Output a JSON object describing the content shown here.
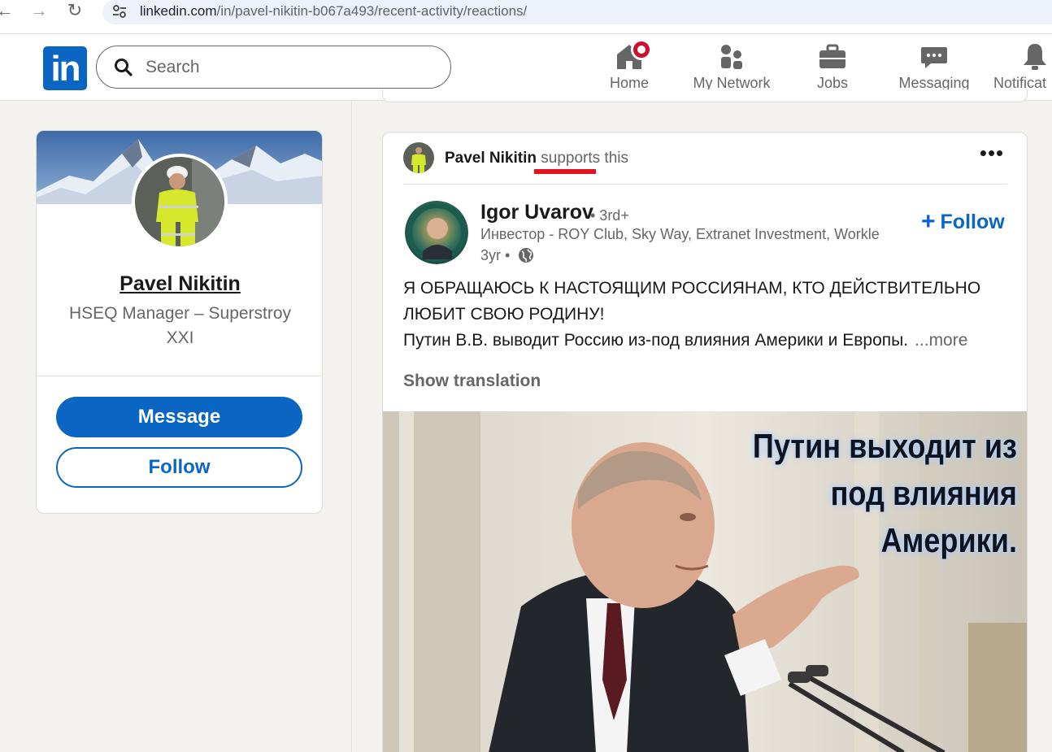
{
  "browser": {
    "url_host": "linkedin.com",
    "url_path": "/in/pavel-nikitin-b067a493/recent-activity/reactions/"
  },
  "header": {
    "logo_text": "in",
    "search_placeholder": "Search",
    "nav": [
      {
        "label": "Home",
        "icon": "home-icon",
        "has_notification": true
      },
      {
        "label": "My Network",
        "icon": "people-icon"
      },
      {
        "label": "Jobs",
        "icon": "briefcase-icon"
      },
      {
        "label": "Messaging",
        "icon": "chat-icon"
      },
      {
        "label": "Notificat",
        "icon": "bell-icon"
      }
    ]
  },
  "profile_card": {
    "name": "Pavel Nikitin",
    "headline": "HSEQ Manager – Superstroy XXI",
    "message_label": "Message",
    "follow_label": "Follow"
  },
  "post": {
    "context_actor": "Pavel Nikitin",
    "context_action": "supports",
    "context_suffix": " this",
    "author_name": "Igor Uvarov",
    "author_degree": "• 3rd+",
    "author_headline": "Инвестор - ROY Club, Sky Way, Extranet Investment, Workle",
    "author_time": "3yr •",
    "follow_label": "Follow",
    "text_line1": "Я ОБРАЩАЮСЬ К НАСТОЯЩИМ РОССИЯНАМ, КТО ДЕЙСТВИТЕЛЬНО",
    "text_line2": "ЛЮБИТ СВОЮ РОДИНУ!",
    "text_line3": "Путин В.В. выводит Россию из-под влияния Америки и Европы.",
    "see_more": "...more",
    "show_translation": "Show translation",
    "image_caption": [
      "Путин выходит из",
      "под влияния",
      "Америки."
    ]
  },
  "colors": {
    "linkedin_blue": "#0a66c2",
    "background": "#f4f2ee",
    "notification_red": "#cb112d",
    "annotation_red": "#e3131f"
  }
}
